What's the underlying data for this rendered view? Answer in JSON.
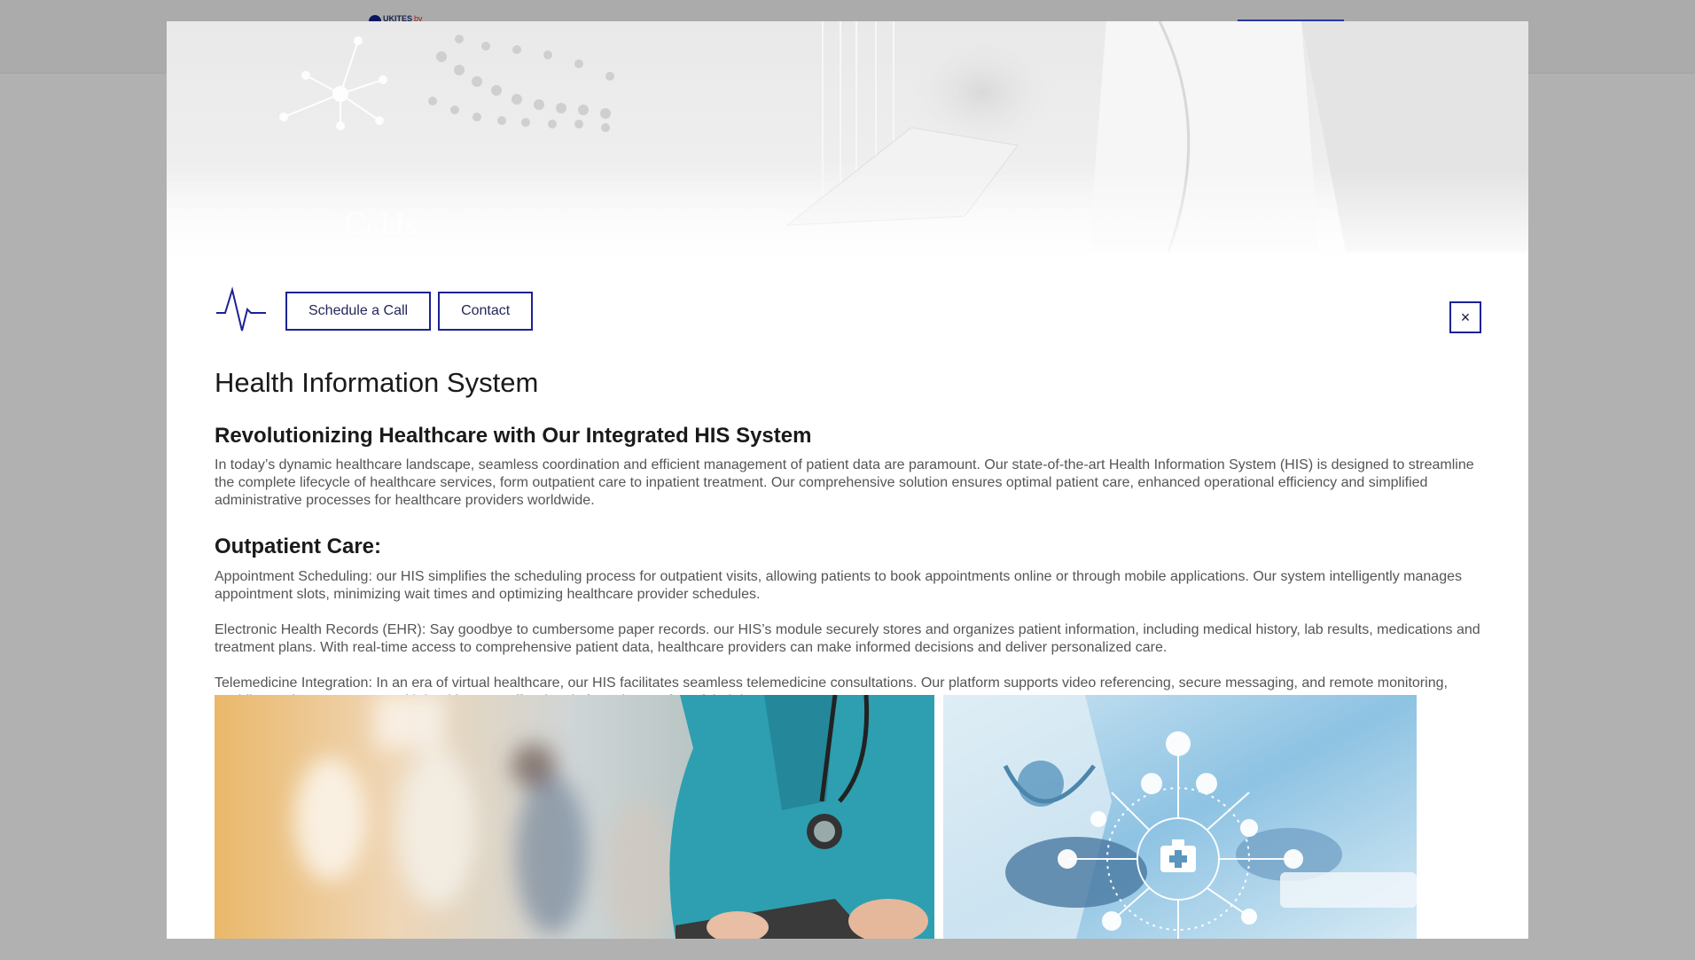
{
  "background_page": {
    "logo_text": "UKITES",
    "logo_suffix": "bv"
  },
  "modal": {
    "toolbar": {
      "schedule_label": "Schedule a Call",
      "contact_label": "Contact",
      "close_label": "×",
      "pulse_icon": "heartbeat-pulse-icon"
    },
    "title": "Health Information System",
    "intro_heading": "Revolutionizing Healthcare with Our Integrated HIS System",
    "intro_text": "In today’s dynamic healthcare landscape, seamless coordination and efficient management of patient data are paramount. Our state-of-the-art Health Information System (HIS) is designed to streamline the complete lifecycle of healthcare services, form outpatient care to inpatient treatment. Our comprehensive solution ensures optimal patient care, enhanced operational efficiency and simplified administrative processes for healthcare providers worldwide.",
    "outpatient_heading": "Outpatient Care:",
    "paragraphs": [
      "Appointment Scheduling: our HIS simplifies the scheduling process for outpatient visits, allowing patients to book appointments online or through mobile applications. Our system intelligently manages appointment slots, minimizing wait times and optimizing healthcare provider schedules.",
      "Electronic Health Records (EHR): Say goodbye to cumbersome paper records. our HIS’s module securely stores and organizes patient information, including medical history, lab results, medications and treatment plans. With real-time access to comprehensive patient data, healthcare providers can make informed decisions and deliver personalized care.",
      "Telemedicine Integration: In an era of virtual healthcare, our HIS facilitates seamless telemedicine consultations. Our platform supports video referencing, secure messaging, and remote monitoring, enabling patients to connect with healthcare proffessionals from the comfort of their homes."
    ]
  },
  "colors": {
    "accent": "#1c2295",
    "overlay": "#b1b1b1",
    "text_body": "#555555"
  }
}
